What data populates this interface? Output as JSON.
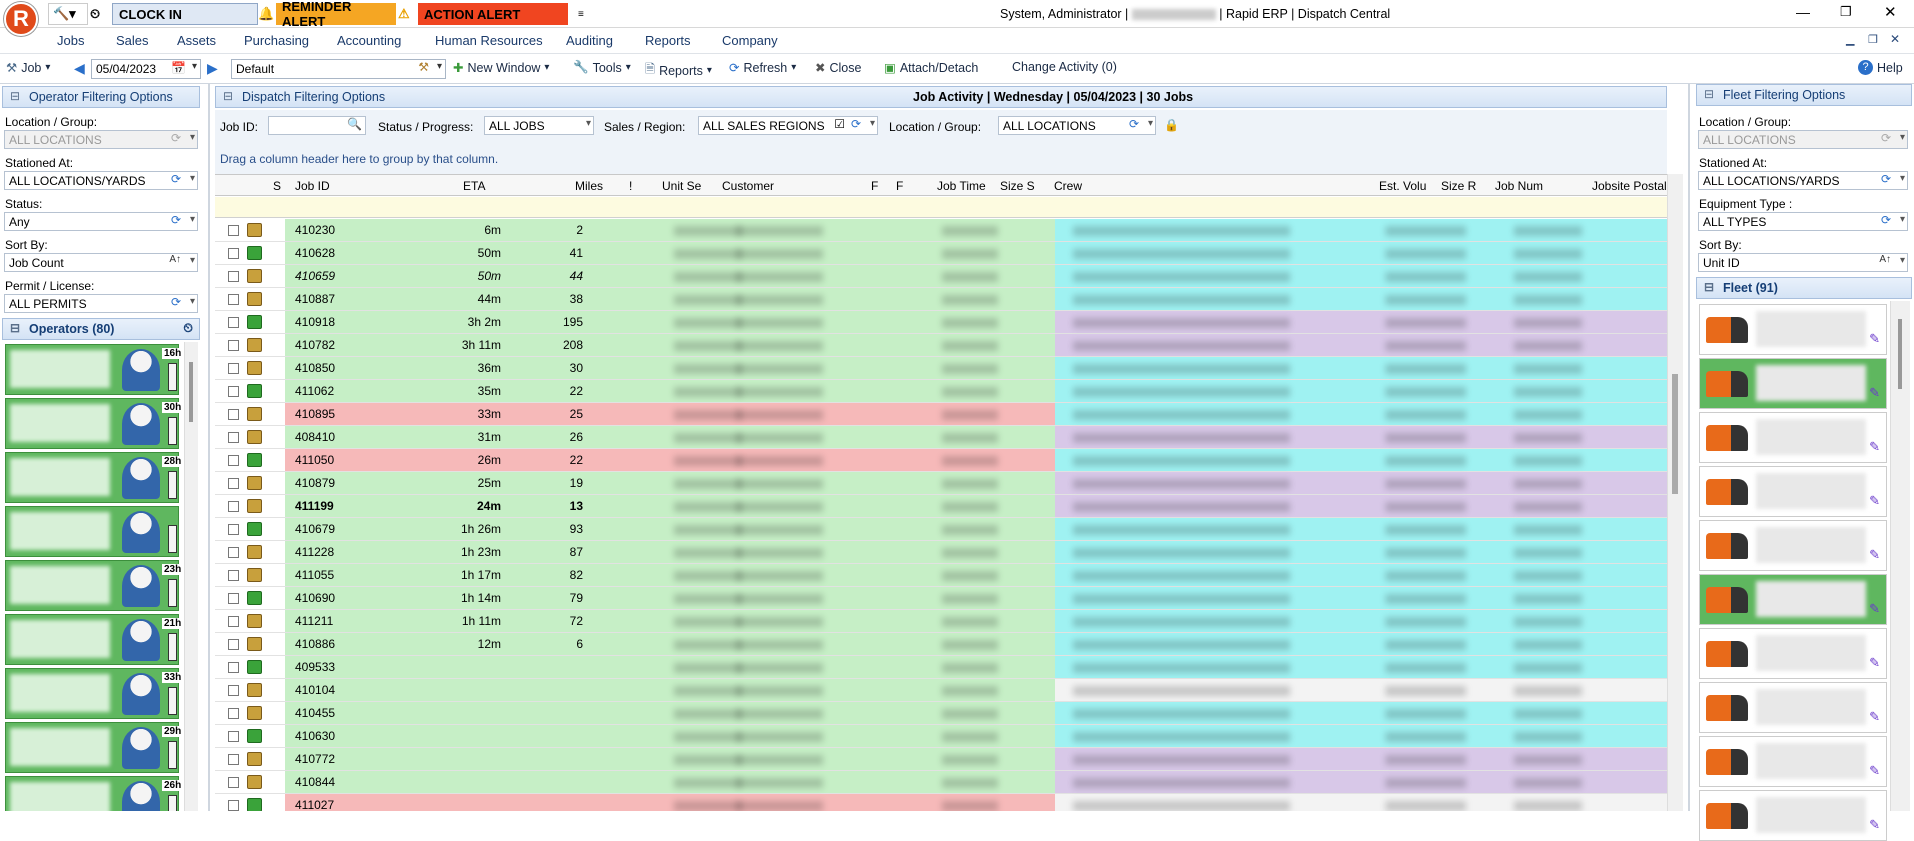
{
  "quick_access": {
    "clock_in": "CLOCK IN",
    "reminder": "REMINDER ALERT",
    "action": "ACTION ALERT"
  },
  "window_title": {
    "user": "System, Administrator",
    "app": "Rapid ERP",
    "module": "Dispatch Central"
  },
  "menu": [
    "Jobs",
    "Sales",
    "Assets",
    "Purchasing",
    "Accounting",
    "Human Resources",
    "Auditing",
    "Reports",
    "Company"
  ],
  "toolbar": {
    "job": "Job",
    "date": "05/04/2023",
    "layout": "Default",
    "new_window": "New Window",
    "tools": "Tools",
    "reports": "Reports",
    "refresh": "Refresh",
    "close": "Close",
    "attach": "Attach/Detach",
    "change_activity": "Change Activity (0)",
    "help": "Help"
  },
  "operator_filter": {
    "header": "Operator Filtering Options",
    "location_label": "Location / Group:",
    "location_value": "ALL LOCATIONS",
    "stationed_label": "Stationed At:",
    "stationed_value": "ALL LOCATIONS/YARDS",
    "status_label": "Status:",
    "status_value": "Any",
    "sort_label": "Sort By:",
    "sort_value": "Job Count",
    "permit_label": "Permit / License:",
    "permit_value": "ALL PERMITS",
    "operators_header": "Operators (80)",
    "operators": [
      {
        "hours": "16h"
      },
      {
        "hours": "30h"
      },
      {
        "hours": "28h"
      },
      {
        "hours": ""
      },
      {
        "hours": "23h"
      },
      {
        "hours": "21h"
      },
      {
        "hours": "33h"
      },
      {
        "hours": "29h"
      },
      {
        "hours": "26h"
      }
    ]
  },
  "dispatch_filter": {
    "header": "Dispatch Filtering Options",
    "activity": "Job Activity | Wednesday | 05/04/2023 | 30 Jobs",
    "job_id_label": "Job ID:",
    "status_label": "Status / Progress:",
    "status_value": "ALL JOBS",
    "sales_label": "Sales / Region:",
    "sales_value": "ALL SALES REGIONS",
    "location_label": "Location / Group:",
    "location_value": "ALL LOCATIONS",
    "group_hint": "Drag a column header here to group by that column."
  },
  "columns": {
    "s": "S",
    "job_id": "Job ID",
    "eta": "ETA",
    "miles": "Miles",
    "excl": "!",
    "unit": "Unit Se",
    "customer": "Customer",
    "f1": "F",
    "f2": "F",
    "job_time": "Job Time",
    "size_s": "Size S",
    "crew": "Crew",
    "est_vol": "Est. Volu",
    "size_r": "Size R",
    "job_num": "Job Num",
    "postal": "Jobsite Postal"
  },
  "rows": [
    {
      "id": "410230",
      "eta": "6m",
      "miles": "2",
      "bg": "green"
    },
    {
      "id": "410628",
      "eta": "50m",
      "miles": "41",
      "bg": "green"
    },
    {
      "id": "410659",
      "eta": "50m",
      "miles": "44",
      "bg": "green",
      "italic": true
    },
    {
      "id": "410887",
      "eta": "44m",
      "miles": "38",
      "bg": "green"
    },
    {
      "id": "410918",
      "eta": "3h 2m",
      "miles": "195",
      "bg": "green"
    },
    {
      "id": "410782",
      "eta": "3h 11m",
      "miles": "208",
      "bg": "green"
    },
    {
      "id": "410850",
      "eta": "36m",
      "miles": "30",
      "bg": "green"
    },
    {
      "id": "411062",
      "eta": "35m",
      "miles": "22",
      "bg": "green"
    },
    {
      "id": "410895",
      "eta": "33m",
      "miles": "25",
      "bg": "red"
    },
    {
      "id": "408410",
      "eta": "31m",
      "miles": "26",
      "bg": "green"
    },
    {
      "id": "411050",
      "eta": "26m",
      "miles": "22",
      "bg": "red"
    },
    {
      "id": "410879",
      "eta": "25m",
      "miles": "19",
      "bg": "green"
    },
    {
      "id": "411199",
      "eta": "24m",
      "miles": "13",
      "bg": "green",
      "bold": true
    },
    {
      "id": "410679",
      "eta": "1h 26m",
      "miles": "93",
      "bg": "green"
    },
    {
      "id": "411228",
      "eta": "1h 23m",
      "miles": "87",
      "bg": "green"
    },
    {
      "id": "411055",
      "eta": "1h 17m",
      "miles": "82",
      "bg": "green"
    },
    {
      "id": "410690",
      "eta": "1h 14m",
      "miles": "79",
      "bg": "green"
    },
    {
      "id": "411211",
      "eta": "1h 11m",
      "miles": "72",
      "bg": "green"
    },
    {
      "id": "410886",
      "eta": "12m",
      "miles": "6",
      "bg": "green"
    },
    {
      "id": "409533",
      "eta": "",
      "miles": "",
      "bg": "green"
    },
    {
      "id": "410104",
      "eta": "",
      "miles": "",
      "bg": "green"
    },
    {
      "id": "410455",
      "eta": "",
      "miles": "",
      "bg": "green"
    },
    {
      "id": "410630",
      "eta": "",
      "miles": "",
      "bg": "green"
    },
    {
      "id": "410772",
      "eta": "",
      "miles": "",
      "bg": "green"
    },
    {
      "id": "410844",
      "eta": "",
      "miles": "",
      "bg": "green"
    },
    {
      "id": "411027",
      "eta": "",
      "miles": "",
      "bg": "red"
    }
  ],
  "fleet_filter": {
    "header": "Fleet Filtering Options",
    "location_label": "Location / Group:",
    "location_value": "ALL LOCATIONS",
    "stationed_label": "Stationed At:",
    "stationed_value": "ALL LOCATIONS/YARDS",
    "equip_label": "Equipment Type :",
    "equip_value": "ALL TYPES",
    "sort_label": "Sort By:",
    "sort_value": "Unit ID",
    "fleet_header": "Fleet (91)"
  },
  "colors": {
    "green_row": "#c6efc6",
    "red_row": "#f6b9b9",
    "cyan_row": "#9ff2f2",
    "purple_row": "#d8c8e8",
    "reminder": "#f5a623",
    "action": "#f04520"
  }
}
